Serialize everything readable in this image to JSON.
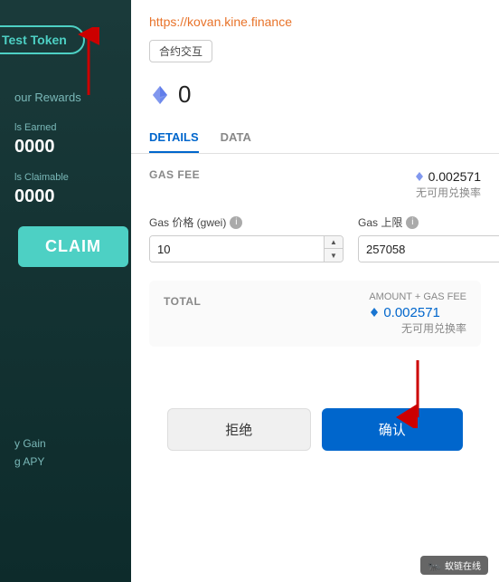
{
  "left_panel": {
    "test_token_label": "Test Token",
    "your_rewards_label": "our Rewards",
    "earned_label": "ls Earned",
    "earned_value": "0000",
    "claimable_label": "ls Claimable",
    "claimable_value": "0000",
    "claim_button": "CLAIM",
    "gain_label": "y Gain",
    "apy_label": "g APY"
  },
  "modal": {
    "url": "https://kovan.kine.finance",
    "contract_tag": "合约交互",
    "eth_amount": "0",
    "tabs": [
      "DETAILS",
      "DATA"
    ],
    "active_tab": "DETAILS",
    "gas_fee_label": "GAS FEE",
    "gas_fee_value": "0.002571",
    "no_exchange": "无可用兑换率",
    "gas_price_label": "Gas 价格 (gwei)",
    "gas_limit_label": "Gas 上限",
    "gas_price_value": "10",
    "gas_limit_value": "257058",
    "amount_gas_label": "AMOUNT + GAS FEE",
    "total_label": "TOTAL",
    "total_value": "0.002571",
    "total_no_exchange": "无可用兑换率",
    "reject_button": "拒绝",
    "confirm_button": "确认"
  },
  "watermark": {
    "text": "蚁链在线"
  },
  "colors": {
    "accent_blue": "#0066cc",
    "teal": "#4dd0c4",
    "dark_bg": "#1a3a3a",
    "eth_orange": "#e8732a",
    "red_arrow": "#cc0000"
  }
}
